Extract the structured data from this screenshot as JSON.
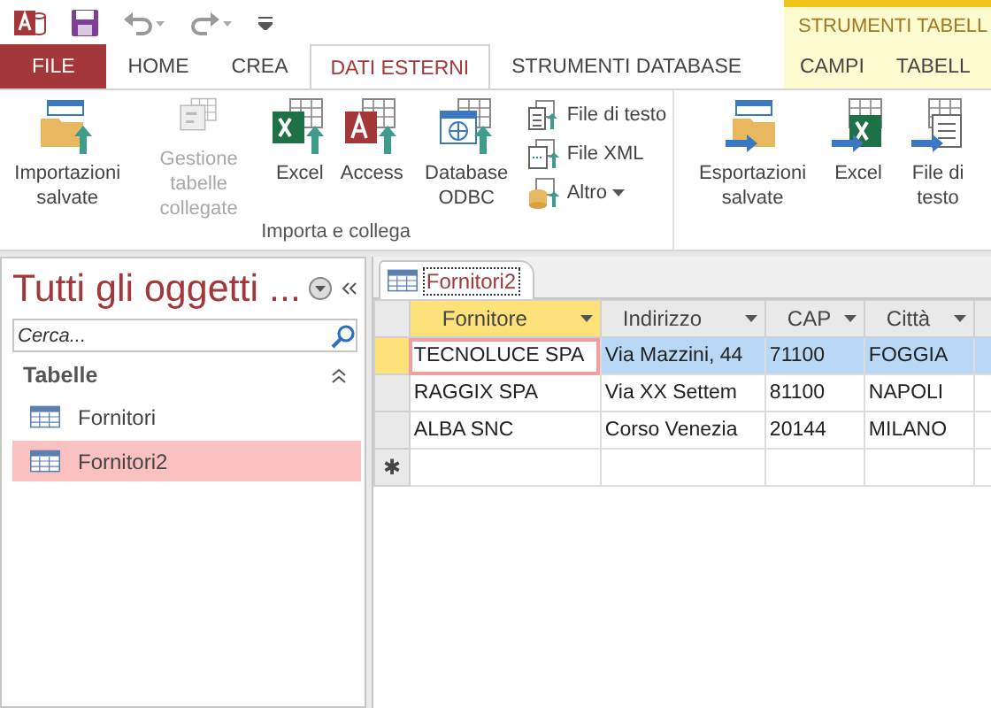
{
  "contextual_group": {
    "label": "STRUMENTI TABELL"
  },
  "tabs": [
    {
      "label": "FILE",
      "kind": "file",
      "selected": false
    },
    {
      "label": "HOME",
      "kind": "normal",
      "selected": false
    },
    {
      "label": "CREA",
      "kind": "normal",
      "selected": false
    },
    {
      "label": "DATI ESTERNI",
      "kind": "normal",
      "selected": true
    },
    {
      "label": "STRUMENTI DATABASE",
      "kind": "normal",
      "selected": false
    },
    {
      "label": "CAMPI",
      "kind": "contextual",
      "selected": false
    },
    {
      "label": "TABELL",
      "kind": "contextual",
      "selected": false
    }
  ],
  "ribbon": {
    "groups": [
      {
        "label": "Importa e collega",
        "buttons": [
          {
            "label": "Importazioni salvate",
            "kind": "large",
            "disabled": false
          },
          {
            "label": "Gestione tabelle collegate",
            "kind": "large",
            "disabled": true
          },
          {
            "label": "Excel",
            "kind": "large",
            "disabled": false
          },
          {
            "label": "Access",
            "kind": "large",
            "disabled": false
          },
          {
            "label": "Database ODBC",
            "kind": "large",
            "disabled": false
          },
          {
            "label": "File di testo",
            "kind": "small",
            "disabled": false
          },
          {
            "label": "File XML",
            "kind": "small",
            "disabled": false
          },
          {
            "label": "Altro",
            "kind": "small",
            "disabled": false,
            "dropdown": true
          }
        ]
      },
      {
        "buttons": [
          {
            "label": "Esportazioni salvate",
            "kind": "large",
            "disabled": false
          },
          {
            "label": "Excel",
            "kind": "large",
            "disabled": false
          },
          {
            "label": "File di testo",
            "kind": "large",
            "disabled": false
          }
        ]
      }
    ]
  },
  "nav_pane": {
    "title": "Tutti gli oggetti ...",
    "search": {
      "placeholder": "Cerca..."
    },
    "groups": [
      {
        "label": "Tabelle",
        "expanded": true,
        "items": [
          {
            "label": "Fornitori",
            "selected": false
          },
          {
            "label": "Fornitori2",
            "selected": true
          }
        ]
      }
    ]
  },
  "document_tab": {
    "label": "Fornitori2"
  },
  "table": {
    "columns": [
      {
        "label": "Fornitore",
        "selected": true
      },
      {
        "label": "Indirizzo",
        "selected": false
      },
      {
        "label": "CAP",
        "selected": false
      },
      {
        "label": "Città",
        "selected": false
      }
    ],
    "rows": [
      {
        "selected": true,
        "cells": [
          "TECNOLUCE SPA",
          "Via Mazzini, 44",
          "71100",
          "FOGGIA"
        ]
      },
      {
        "selected": false,
        "cells": [
          "RAGGIX SPA",
          "Via XX Settem",
          "81100",
          "NAPOLI"
        ]
      },
      {
        "selected": false,
        "cells": [
          "ALBA SNC",
          "Corso Venezia",
          "20144",
          "MILANO"
        ]
      }
    ],
    "new_row_marker": "✱"
  }
}
